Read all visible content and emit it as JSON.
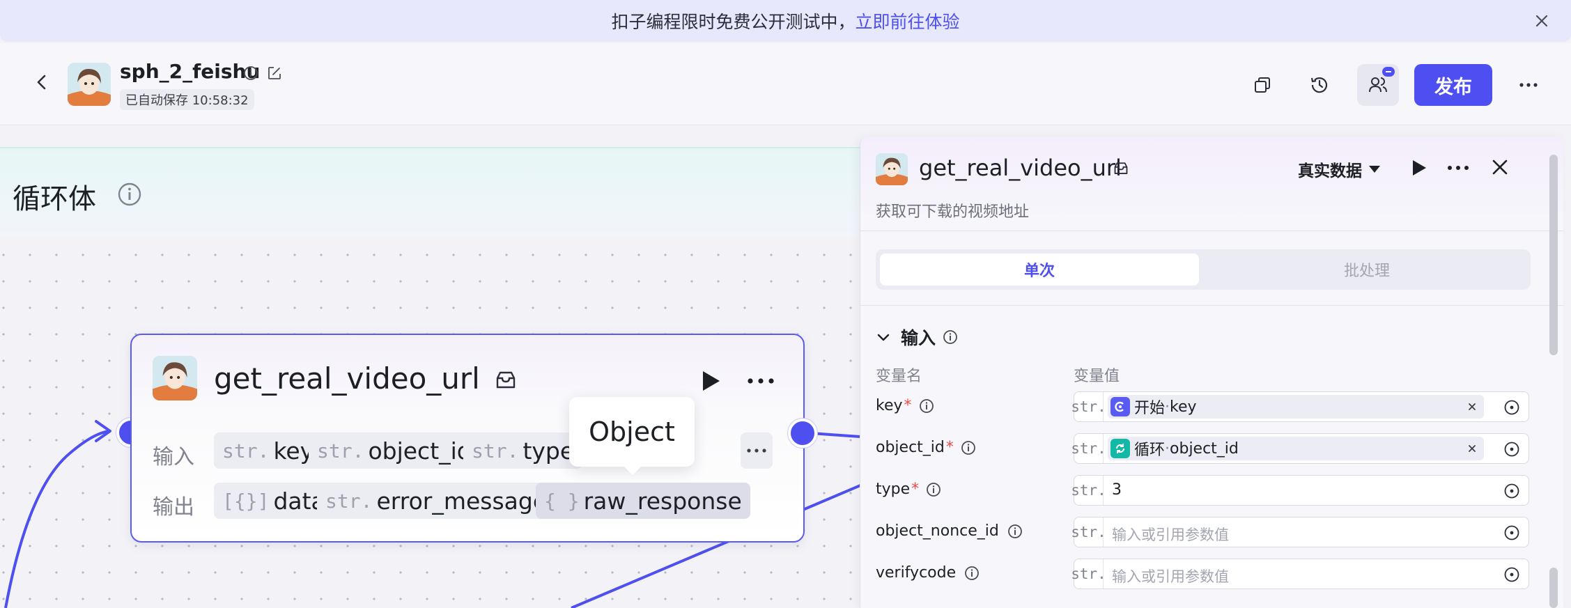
{
  "banner": {
    "text": "扣子编程限时免费公开测试中，",
    "link": "立即前往体验"
  },
  "header": {
    "project_name": "sph_2_feishu",
    "autosave": "已自动保存 10:58:32",
    "publish_label": "发布"
  },
  "canvas": {
    "loop_title": "循环体",
    "node": {
      "title": "get_real_video_url",
      "input_label": "输入",
      "output_label": "输出",
      "inputs": [
        {
          "type": "str.",
          "name": "key"
        },
        {
          "type": "str.",
          "name": "object_id"
        },
        {
          "type": "str.",
          "name": "type"
        }
      ],
      "outputs": [
        {
          "type": "[{}]",
          "name": "data"
        },
        {
          "type": "str.",
          "name": "error_message"
        },
        {
          "type": "{ }",
          "name": "raw_response"
        }
      ],
      "more_label": "···"
    },
    "tooltip": "Object"
  },
  "panel": {
    "title": "get_real_video_url",
    "description": "获取可下载的视频地址",
    "data_mode": "真实数据",
    "tabs": [
      {
        "label": "单次",
        "active": true
      },
      {
        "label": "批处理",
        "active": false
      }
    ],
    "section_title": "输入",
    "col_name": "变量名",
    "col_value": "变量值",
    "params": [
      {
        "name": "key",
        "required": "*",
        "type": "str.",
        "ref_source": "开始",
        "ref_sep": " · ",
        "ref_field": "key",
        "value": "",
        "placeholder": ""
      },
      {
        "name": "object_id",
        "required": "*",
        "type": "str.",
        "ref_source": "循环",
        "ref_sep": " · ",
        "ref_field": "object_id",
        "value": "",
        "placeholder": ""
      },
      {
        "name": "type",
        "required": "*",
        "type": "str.",
        "ref_source": "",
        "ref_sep": "",
        "ref_field": "",
        "value": "3",
        "placeholder": ""
      },
      {
        "name": "object_nonce_id",
        "required": "",
        "type": "str.",
        "ref_source": "",
        "ref_sep": "",
        "ref_field": "",
        "value": "",
        "placeholder": "输入或引用参数值"
      },
      {
        "name": "verifycode",
        "required": "",
        "type": "str.",
        "ref_source": "",
        "ref_sep": "",
        "ref_field": "",
        "value": "",
        "placeholder": "输入或引用参数值"
      }
    ]
  },
  "colors": {
    "accent": "#4e4ff0",
    "edge": "#4e4ff0",
    "required": "#f54a45",
    "start_ref": "#5a5bf0",
    "loop_ref": "#14b8a6"
  },
  "icons": {
    "close": "close-icon",
    "back": "back-arrow-icon",
    "info": "info-icon",
    "edit": "edit-icon",
    "copy": "copy-icon",
    "history": "history-icon",
    "collab": "collaborators-icon",
    "more": "more-icon",
    "plugin": "plugin-icon",
    "run": "play-icon",
    "target": "reference-target-icon",
    "chevron": "chevron-down-icon"
  }
}
